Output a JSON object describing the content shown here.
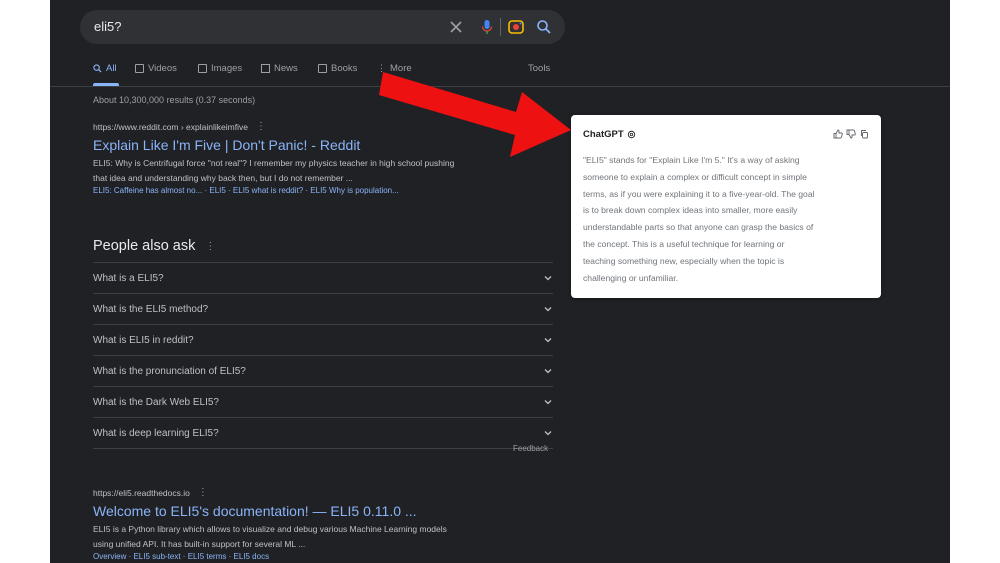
{
  "search": {
    "query": "eli5?"
  },
  "tabs": [
    {
      "label": "All",
      "icon": "search-icon"
    },
    {
      "label": "Videos",
      "icon": "video-icon"
    },
    {
      "label": "Images",
      "icon": "image-icon"
    },
    {
      "label": "News",
      "icon": "news-icon"
    },
    {
      "label": "Books",
      "icon": "book-icon"
    },
    {
      "label": "More",
      "icon": "more-icon"
    }
  ],
  "tools_label": "Tools",
  "stats": "About 10,300,000 results (0.37 seconds)",
  "results": [
    {
      "url": "https://www.reddit.com › explainlikeimfive",
      "title": "Explain Like I'm Five | Don't Panic! - Reddit",
      "snippet_1": "ELI5: Why is Centrifugal force \"not real\"? I remember my physics teacher in high school pushing",
      "snippet_2": "that idea and understanding why back then, but I do not remember ...",
      "links": "ELI5: Caffeine has almost no... · ELI5 · ELI5 what is reddit? · ELI5 Why is population..."
    },
    {
      "url": "https://eli5.readthedocs.io",
      "title": "Welcome to ELI5's documentation! — ELI5 0.11.0 ...",
      "snippet_1": "ELI5 is a Python library which allows to visualize and debug various Machine Learning models",
      "snippet_2": "using unified API. It has built-in support for several ML ...",
      "links": "Overview · ELI5 sub-text · ELI5 terms · ELI5 docs"
    }
  ],
  "paa": {
    "title": "People also ask",
    "questions": [
      "What is a ELI5?",
      "What is the ELI5 method?",
      "What is ELI5 in reddit?",
      "What is the pronunciation of ELI5?",
      "What is the Dark Web ELI5?",
      "What is deep learning ELI5?"
    ],
    "feedback": "Feedback"
  },
  "chatgpt": {
    "title": "ChatGPT",
    "lines": [
      "\"ELI5\" stands for \"Explain Like I'm 5.\" It's a way of asking",
      "someone to explain a complex or difficult concept in simple",
      "terms, as if you were explaining it to a five-year-old. The goal",
      "is to break down complex ideas into smaller, more easily",
      "understandable parts so that anyone can grasp the basics of",
      "the concept. This is a useful technique for learning or",
      "teaching something new, especially when the topic is",
      "challenging or unfamiliar."
    ]
  },
  "colors": {
    "background": "#202124",
    "link": "#8ab4f8",
    "arrow": "#ee1111"
  }
}
